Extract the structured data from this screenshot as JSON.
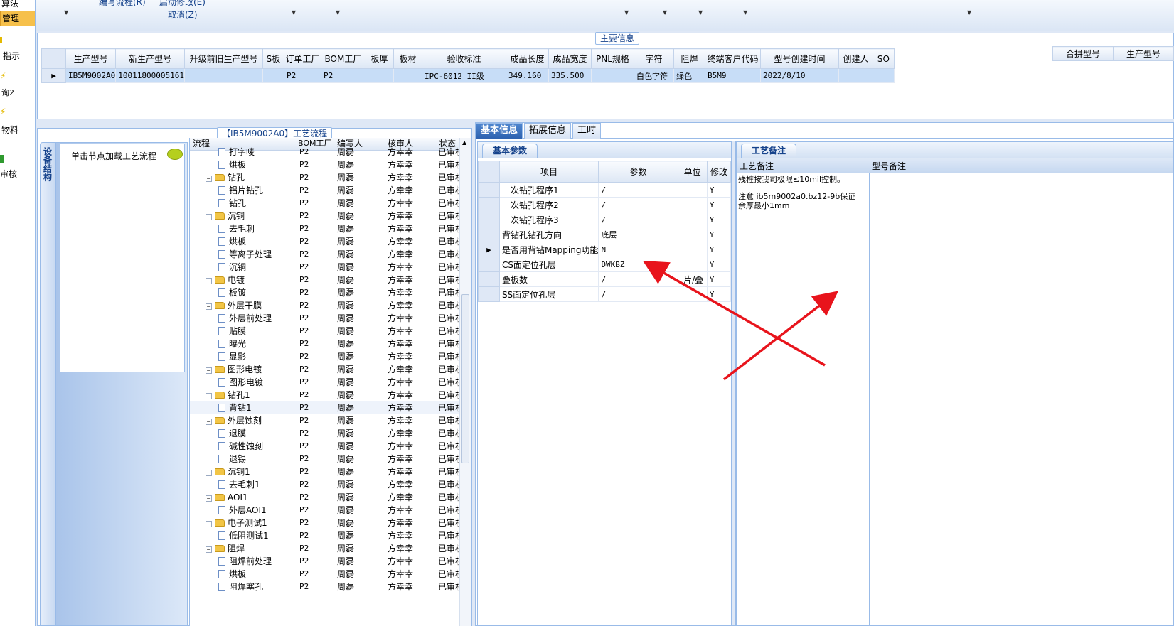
{
  "sidebar": {
    "items": [
      {
        "label": "算法",
        "selected": false
      },
      {
        "label": "管理",
        "selected": true
      },
      {
        "label": "指示",
        "selected": false
      },
      {
        "label": "询2",
        "selected": false
      },
      {
        "label": "物料",
        "selected": false
      },
      {
        "label": "审核",
        "selected": false
      }
    ]
  },
  "toolbar": {
    "item1": "编写流程(R)",
    "item2": "启动修改(E)",
    "item3": "取消(Z)"
  },
  "main_info": {
    "caption": "主要信息",
    "columns": [
      "生产型号",
      "新生产型号",
      "升级前旧生产型号",
      "S板",
      "订单工厂",
      "BOM工厂",
      "板厚",
      "板材",
      "验收标准",
      "成品长度",
      "成品宽度",
      "PNL规格",
      "字符",
      "阻焊",
      "终端客户代码",
      "型号创建时间",
      "创建人",
      "SO"
    ],
    "rows": [
      [
        "IB5M9002A0",
        "10011800005161",
        "",
        "",
        "P2",
        "P2",
        "",
        "",
        "IPC-6012 II级",
        "349.160",
        "335.500",
        "",
        "白色字符",
        "绿色",
        "B5M9",
        "2022/8/10",
        "",
        ""
      ]
    ],
    "side_columns": [
      "合拼型号",
      "生产型号"
    ]
  },
  "flow": {
    "caption": "【IB5M9002A0】工艺流程",
    "vertical_tab": "设备结构",
    "node_hint": "单击节点加载工艺流程",
    "columns": [
      "流程",
      "BOM工厂",
      "编写人",
      "核审人",
      "状态"
    ],
    "rows": [
      {
        "name": "打字唛",
        "type": "file",
        "factory": "P2",
        "writer": "周磊",
        "reviewer": "方幸幸",
        "status": "已审核"
      },
      {
        "name": "烘板",
        "type": "file",
        "factory": "P2",
        "writer": "周磊",
        "reviewer": "方幸幸",
        "status": "已审核"
      },
      {
        "name": "钻孔",
        "type": "folder",
        "factory": "P2",
        "writer": "周磊",
        "reviewer": "方幸幸",
        "status": "已审核"
      },
      {
        "name": "铝片钻孔",
        "type": "file",
        "factory": "P2",
        "writer": "周磊",
        "reviewer": "方幸幸",
        "status": "已审核"
      },
      {
        "name": "钻孔",
        "type": "file",
        "factory": "P2",
        "writer": "周磊",
        "reviewer": "方幸幸",
        "status": "已审核"
      },
      {
        "name": "沉铜",
        "type": "folder",
        "factory": "P2",
        "writer": "周磊",
        "reviewer": "方幸幸",
        "status": "已审核"
      },
      {
        "name": "去毛刺",
        "type": "file",
        "factory": "P2",
        "writer": "周磊",
        "reviewer": "方幸幸",
        "status": "已审核"
      },
      {
        "name": "烘板",
        "type": "file",
        "factory": "P2",
        "writer": "周磊",
        "reviewer": "方幸幸",
        "status": "已审核"
      },
      {
        "name": "等离子处理",
        "type": "file",
        "factory": "P2",
        "writer": "周磊",
        "reviewer": "方幸幸",
        "status": "已审核"
      },
      {
        "name": "沉铜",
        "type": "file",
        "factory": "P2",
        "writer": "周磊",
        "reviewer": "方幸幸",
        "status": "已审核"
      },
      {
        "name": "电镀",
        "type": "folder",
        "factory": "P2",
        "writer": "周磊",
        "reviewer": "方幸幸",
        "status": "已审核"
      },
      {
        "name": "板镀",
        "type": "file",
        "factory": "P2",
        "writer": "周磊",
        "reviewer": "方幸幸",
        "status": "已审核"
      },
      {
        "name": "外层干膜",
        "type": "folder",
        "factory": "P2",
        "writer": "周磊",
        "reviewer": "方幸幸",
        "status": "已审核"
      },
      {
        "name": "外层前处理",
        "type": "file",
        "factory": "P2",
        "writer": "周磊",
        "reviewer": "方幸幸",
        "status": "已审核"
      },
      {
        "name": "贴膜",
        "type": "file",
        "factory": "P2",
        "writer": "周磊",
        "reviewer": "方幸幸",
        "status": "已审核"
      },
      {
        "name": "曝光",
        "type": "file",
        "factory": "P2",
        "writer": "周磊",
        "reviewer": "方幸幸",
        "status": "已审核"
      },
      {
        "name": "显影",
        "type": "file",
        "factory": "P2",
        "writer": "周磊",
        "reviewer": "方幸幸",
        "status": "已审核"
      },
      {
        "name": "图形电镀",
        "type": "folder",
        "factory": "P2",
        "writer": "周磊",
        "reviewer": "方幸幸",
        "status": "已审核"
      },
      {
        "name": "图形电镀",
        "type": "file",
        "factory": "P2",
        "writer": "周磊",
        "reviewer": "方幸幸",
        "status": "已审核"
      },
      {
        "name": "钻孔1",
        "type": "folder",
        "factory": "P2",
        "writer": "周磊",
        "reviewer": "方幸幸",
        "status": "已审核"
      },
      {
        "name": "背钻1",
        "type": "file",
        "factory": "P2",
        "writer": "周磊",
        "reviewer": "方幸幸",
        "status": "已审核",
        "selected": true
      },
      {
        "name": "外层蚀刻",
        "type": "folder",
        "factory": "P2",
        "writer": "周磊",
        "reviewer": "方幸幸",
        "status": "已审核"
      },
      {
        "name": "退膜",
        "type": "file",
        "factory": "P2",
        "writer": "周磊",
        "reviewer": "方幸幸",
        "status": "已审核"
      },
      {
        "name": "碱性蚀刻",
        "type": "file",
        "factory": "P2",
        "writer": "周磊",
        "reviewer": "方幸幸",
        "status": "已审核"
      },
      {
        "name": "退锡",
        "type": "file",
        "factory": "P2",
        "writer": "周磊",
        "reviewer": "方幸幸",
        "status": "已审核"
      },
      {
        "name": "沉铜1",
        "type": "folder",
        "factory": "P2",
        "writer": "周磊",
        "reviewer": "方幸幸",
        "status": "已审核"
      },
      {
        "name": "去毛刺1",
        "type": "file",
        "factory": "P2",
        "writer": "周磊",
        "reviewer": "方幸幸",
        "status": "已审核"
      },
      {
        "name": "AOI1",
        "type": "folder",
        "factory": "P2",
        "writer": "周磊",
        "reviewer": "方幸幸",
        "status": "已审核"
      },
      {
        "name": "外层AOI1",
        "type": "file",
        "factory": "P2",
        "writer": "周磊",
        "reviewer": "方幸幸",
        "status": "已审核"
      },
      {
        "name": "电子测试1",
        "type": "folder",
        "factory": "P2",
        "writer": "周磊",
        "reviewer": "方幸幸",
        "status": "已审核"
      },
      {
        "name": "低阻测试1",
        "type": "file",
        "factory": "P2",
        "writer": "周磊",
        "reviewer": "方幸幸",
        "status": "已审核"
      },
      {
        "name": "阻焊",
        "type": "folder",
        "factory": "P2",
        "writer": "周磊",
        "reviewer": "方幸幸",
        "status": "已审核"
      },
      {
        "name": "阻焊前处理",
        "type": "file",
        "factory": "P2",
        "writer": "周磊",
        "reviewer": "方幸幸",
        "status": "已审核"
      },
      {
        "name": "烘板",
        "type": "file",
        "factory": "P2",
        "writer": "周磊",
        "reviewer": "方幸幸",
        "status": "已审核"
      },
      {
        "name": "阻焊塞孔",
        "type": "file",
        "factory": "P2",
        "writer": "周磊",
        "reviewer": "方幸幸",
        "status": "已审核"
      }
    ]
  },
  "detail": {
    "tabs": [
      "基本信息",
      "拓展信息",
      "工时"
    ],
    "active_tab": 0,
    "basic_params": {
      "subtab": "基本参数",
      "columns": [
        "项目",
        "参数",
        "单位",
        "修改"
      ],
      "rows": [
        [
          "一次钻孔程序1",
          "/",
          "",
          "Y"
        ],
        [
          "一次钻孔程序2",
          "/",
          "",
          "Y"
        ],
        [
          "一次钻孔程序3",
          "/",
          "",
          "Y"
        ],
        [
          "背钻孔钻孔方向",
          "底层",
          "",
          "Y"
        ],
        [
          "是否用背钻Mapping功能",
          "N",
          "",
          "Y"
        ],
        [
          "CS面定位孔层",
          "DWKBZ",
          "",
          "Y"
        ],
        [
          "叠板数",
          "/",
          "片/叠",
          "Y"
        ],
        [
          "SS面定位孔层",
          "/",
          "",
          "Y"
        ]
      ],
      "selected_row": 4
    },
    "remarks": {
      "subtab": "工艺备注",
      "col1": "工艺备注",
      "col2": "型号备注",
      "line1": "残桩按我司极限≤10mil控制。",
      "line2": "注意 ib5m9002a0.bz12-9b保证余厚最小1mm"
    }
  },
  "colors": {
    "accent": "#2d62b0",
    "selection": "#c7ddf7",
    "annotation": "#e8141c"
  }
}
